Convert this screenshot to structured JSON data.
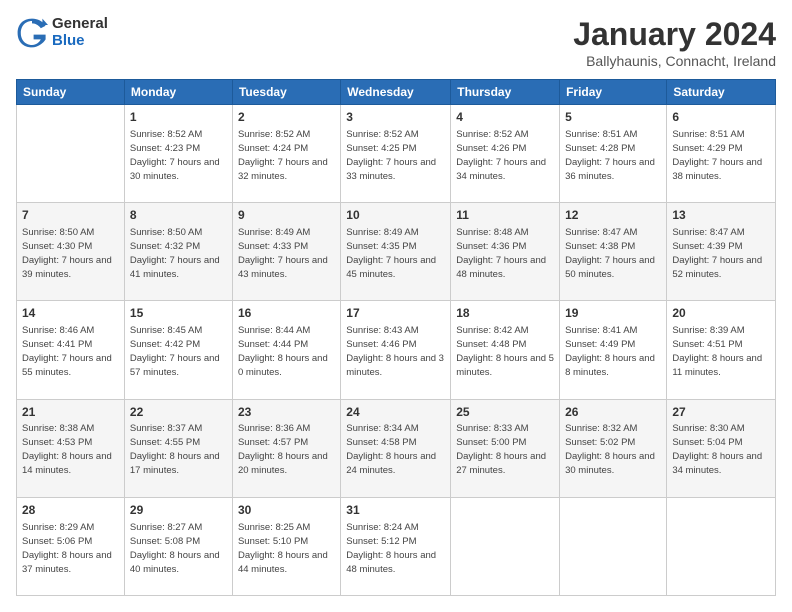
{
  "logo": {
    "general": "General",
    "blue": "Blue"
  },
  "title": "January 2024",
  "location": "Ballyhaunis, Connacht, Ireland",
  "days_of_week": [
    "Sunday",
    "Monday",
    "Tuesday",
    "Wednesday",
    "Thursday",
    "Friday",
    "Saturday"
  ],
  "weeks": [
    [
      {
        "day": "",
        "sunrise": "",
        "sunset": "",
        "daylight": ""
      },
      {
        "day": "1",
        "sunrise": "Sunrise: 8:52 AM",
        "sunset": "Sunset: 4:23 PM",
        "daylight": "Daylight: 7 hours and 30 minutes."
      },
      {
        "day": "2",
        "sunrise": "Sunrise: 8:52 AM",
        "sunset": "Sunset: 4:24 PM",
        "daylight": "Daylight: 7 hours and 32 minutes."
      },
      {
        "day": "3",
        "sunrise": "Sunrise: 8:52 AM",
        "sunset": "Sunset: 4:25 PM",
        "daylight": "Daylight: 7 hours and 33 minutes."
      },
      {
        "day": "4",
        "sunrise": "Sunrise: 8:52 AM",
        "sunset": "Sunset: 4:26 PM",
        "daylight": "Daylight: 7 hours and 34 minutes."
      },
      {
        "day": "5",
        "sunrise": "Sunrise: 8:51 AM",
        "sunset": "Sunset: 4:28 PM",
        "daylight": "Daylight: 7 hours and 36 minutes."
      },
      {
        "day": "6",
        "sunrise": "Sunrise: 8:51 AM",
        "sunset": "Sunset: 4:29 PM",
        "daylight": "Daylight: 7 hours and 38 minutes."
      }
    ],
    [
      {
        "day": "7",
        "sunrise": "Sunrise: 8:50 AM",
        "sunset": "Sunset: 4:30 PM",
        "daylight": "Daylight: 7 hours and 39 minutes."
      },
      {
        "day": "8",
        "sunrise": "Sunrise: 8:50 AM",
        "sunset": "Sunset: 4:32 PM",
        "daylight": "Daylight: 7 hours and 41 minutes."
      },
      {
        "day": "9",
        "sunrise": "Sunrise: 8:49 AM",
        "sunset": "Sunset: 4:33 PM",
        "daylight": "Daylight: 7 hours and 43 minutes."
      },
      {
        "day": "10",
        "sunrise": "Sunrise: 8:49 AM",
        "sunset": "Sunset: 4:35 PM",
        "daylight": "Daylight: 7 hours and 45 minutes."
      },
      {
        "day": "11",
        "sunrise": "Sunrise: 8:48 AM",
        "sunset": "Sunset: 4:36 PM",
        "daylight": "Daylight: 7 hours and 48 minutes."
      },
      {
        "day": "12",
        "sunrise": "Sunrise: 8:47 AM",
        "sunset": "Sunset: 4:38 PM",
        "daylight": "Daylight: 7 hours and 50 minutes."
      },
      {
        "day": "13",
        "sunrise": "Sunrise: 8:47 AM",
        "sunset": "Sunset: 4:39 PM",
        "daylight": "Daylight: 7 hours and 52 minutes."
      }
    ],
    [
      {
        "day": "14",
        "sunrise": "Sunrise: 8:46 AM",
        "sunset": "Sunset: 4:41 PM",
        "daylight": "Daylight: 7 hours and 55 minutes."
      },
      {
        "day": "15",
        "sunrise": "Sunrise: 8:45 AM",
        "sunset": "Sunset: 4:42 PM",
        "daylight": "Daylight: 7 hours and 57 minutes."
      },
      {
        "day": "16",
        "sunrise": "Sunrise: 8:44 AM",
        "sunset": "Sunset: 4:44 PM",
        "daylight": "Daylight: 8 hours and 0 minutes."
      },
      {
        "day": "17",
        "sunrise": "Sunrise: 8:43 AM",
        "sunset": "Sunset: 4:46 PM",
        "daylight": "Daylight: 8 hours and 3 minutes."
      },
      {
        "day": "18",
        "sunrise": "Sunrise: 8:42 AM",
        "sunset": "Sunset: 4:48 PM",
        "daylight": "Daylight: 8 hours and 5 minutes."
      },
      {
        "day": "19",
        "sunrise": "Sunrise: 8:41 AM",
        "sunset": "Sunset: 4:49 PM",
        "daylight": "Daylight: 8 hours and 8 minutes."
      },
      {
        "day": "20",
        "sunrise": "Sunrise: 8:39 AM",
        "sunset": "Sunset: 4:51 PM",
        "daylight": "Daylight: 8 hours and 11 minutes."
      }
    ],
    [
      {
        "day": "21",
        "sunrise": "Sunrise: 8:38 AM",
        "sunset": "Sunset: 4:53 PM",
        "daylight": "Daylight: 8 hours and 14 minutes."
      },
      {
        "day": "22",
        "sunrise": "Sunrise: 8:37 AM",
        "sunset": "Sunset: 4:55 PM",
        "daylight": "Daylight: 8 hours and 17 minutes."
      },
      {
        "day": "23",
        "sunrise": "Sunrise: 8:36 AM",
        "sunset": "Sunset: 4:57 PM",
        "daylight": "Daylight: 8 hours and 20 minutes."
      },
      {
        "day": "24",
        "sunrise": "Sunrise: 8:34 AM",
        "sunset": "Sunset: 4:58 PM",
        "daylight": "Daylight: 8 hours and 24 minutes."
      },
      {
        "day": "25",
        "sunrise": "Sunrise: 8:33 AM",
        "sunset": "Sunset: 5:00 PM",
        "daylight": "Daylight: 8 hours and 27 minutes."
      },
      {
        "day": "26",
        "sunrise": "Sunrise: 8:32 AM",
        "sunset": "Sunset: 5:02 PM",
        "daylight": "Daylight: 8 hours and 30 minutes."
      },
      {
        "day": "27",
        "sunrise": "Sunrise: 8:30 AM",
        "sunset": "Sunset: 5:04 PM",
        "daylight": "Daylight: 8 hours and 34 minutes."
      }
    ],
    [
      {
        "day": "28",
        "sunrise": "Sunrise: 8:29 AM",
        "sunset": "Sunset: 5:06 PM",
        "daylight": "Daylight: 8 hours and 37 minutes."
      },
      {
        "day": "29",
        "sunrise": "Sunrise: 8:27 AM",
        "sunset": "Sunset: 5:08 PM",
        "daylight": "Daylight: 8 hours and 40 minutes."
      },
      {
        "day": "30",
        "sunrise": "Sunrise: 8:25 AM",
        "sunset": "Sunset: 5:10 PM",
        "daylight": "Daylight: 8 hours and 44 minutes."
      },
      {
        "day": "31",
        "sunrise": "Sunrise: 8:24 AM",
        "sunset": "Sunset: 5:12 PM",
        "daylight": "Daylight: 8 hours and 48 minutes."
      },
      {
        "day": "",
        "sunrise": "",
        "sunset": "",
        "daylight": ""
      },
      {
        "day": "",
        "sunrise": "",
        "sunset": "",
        "daylight": ""
      },
      {
        "day": "",
        "sunrise": "",
        "sunset": "",
        "daylight": ""
      }
    ]
  ]
}
